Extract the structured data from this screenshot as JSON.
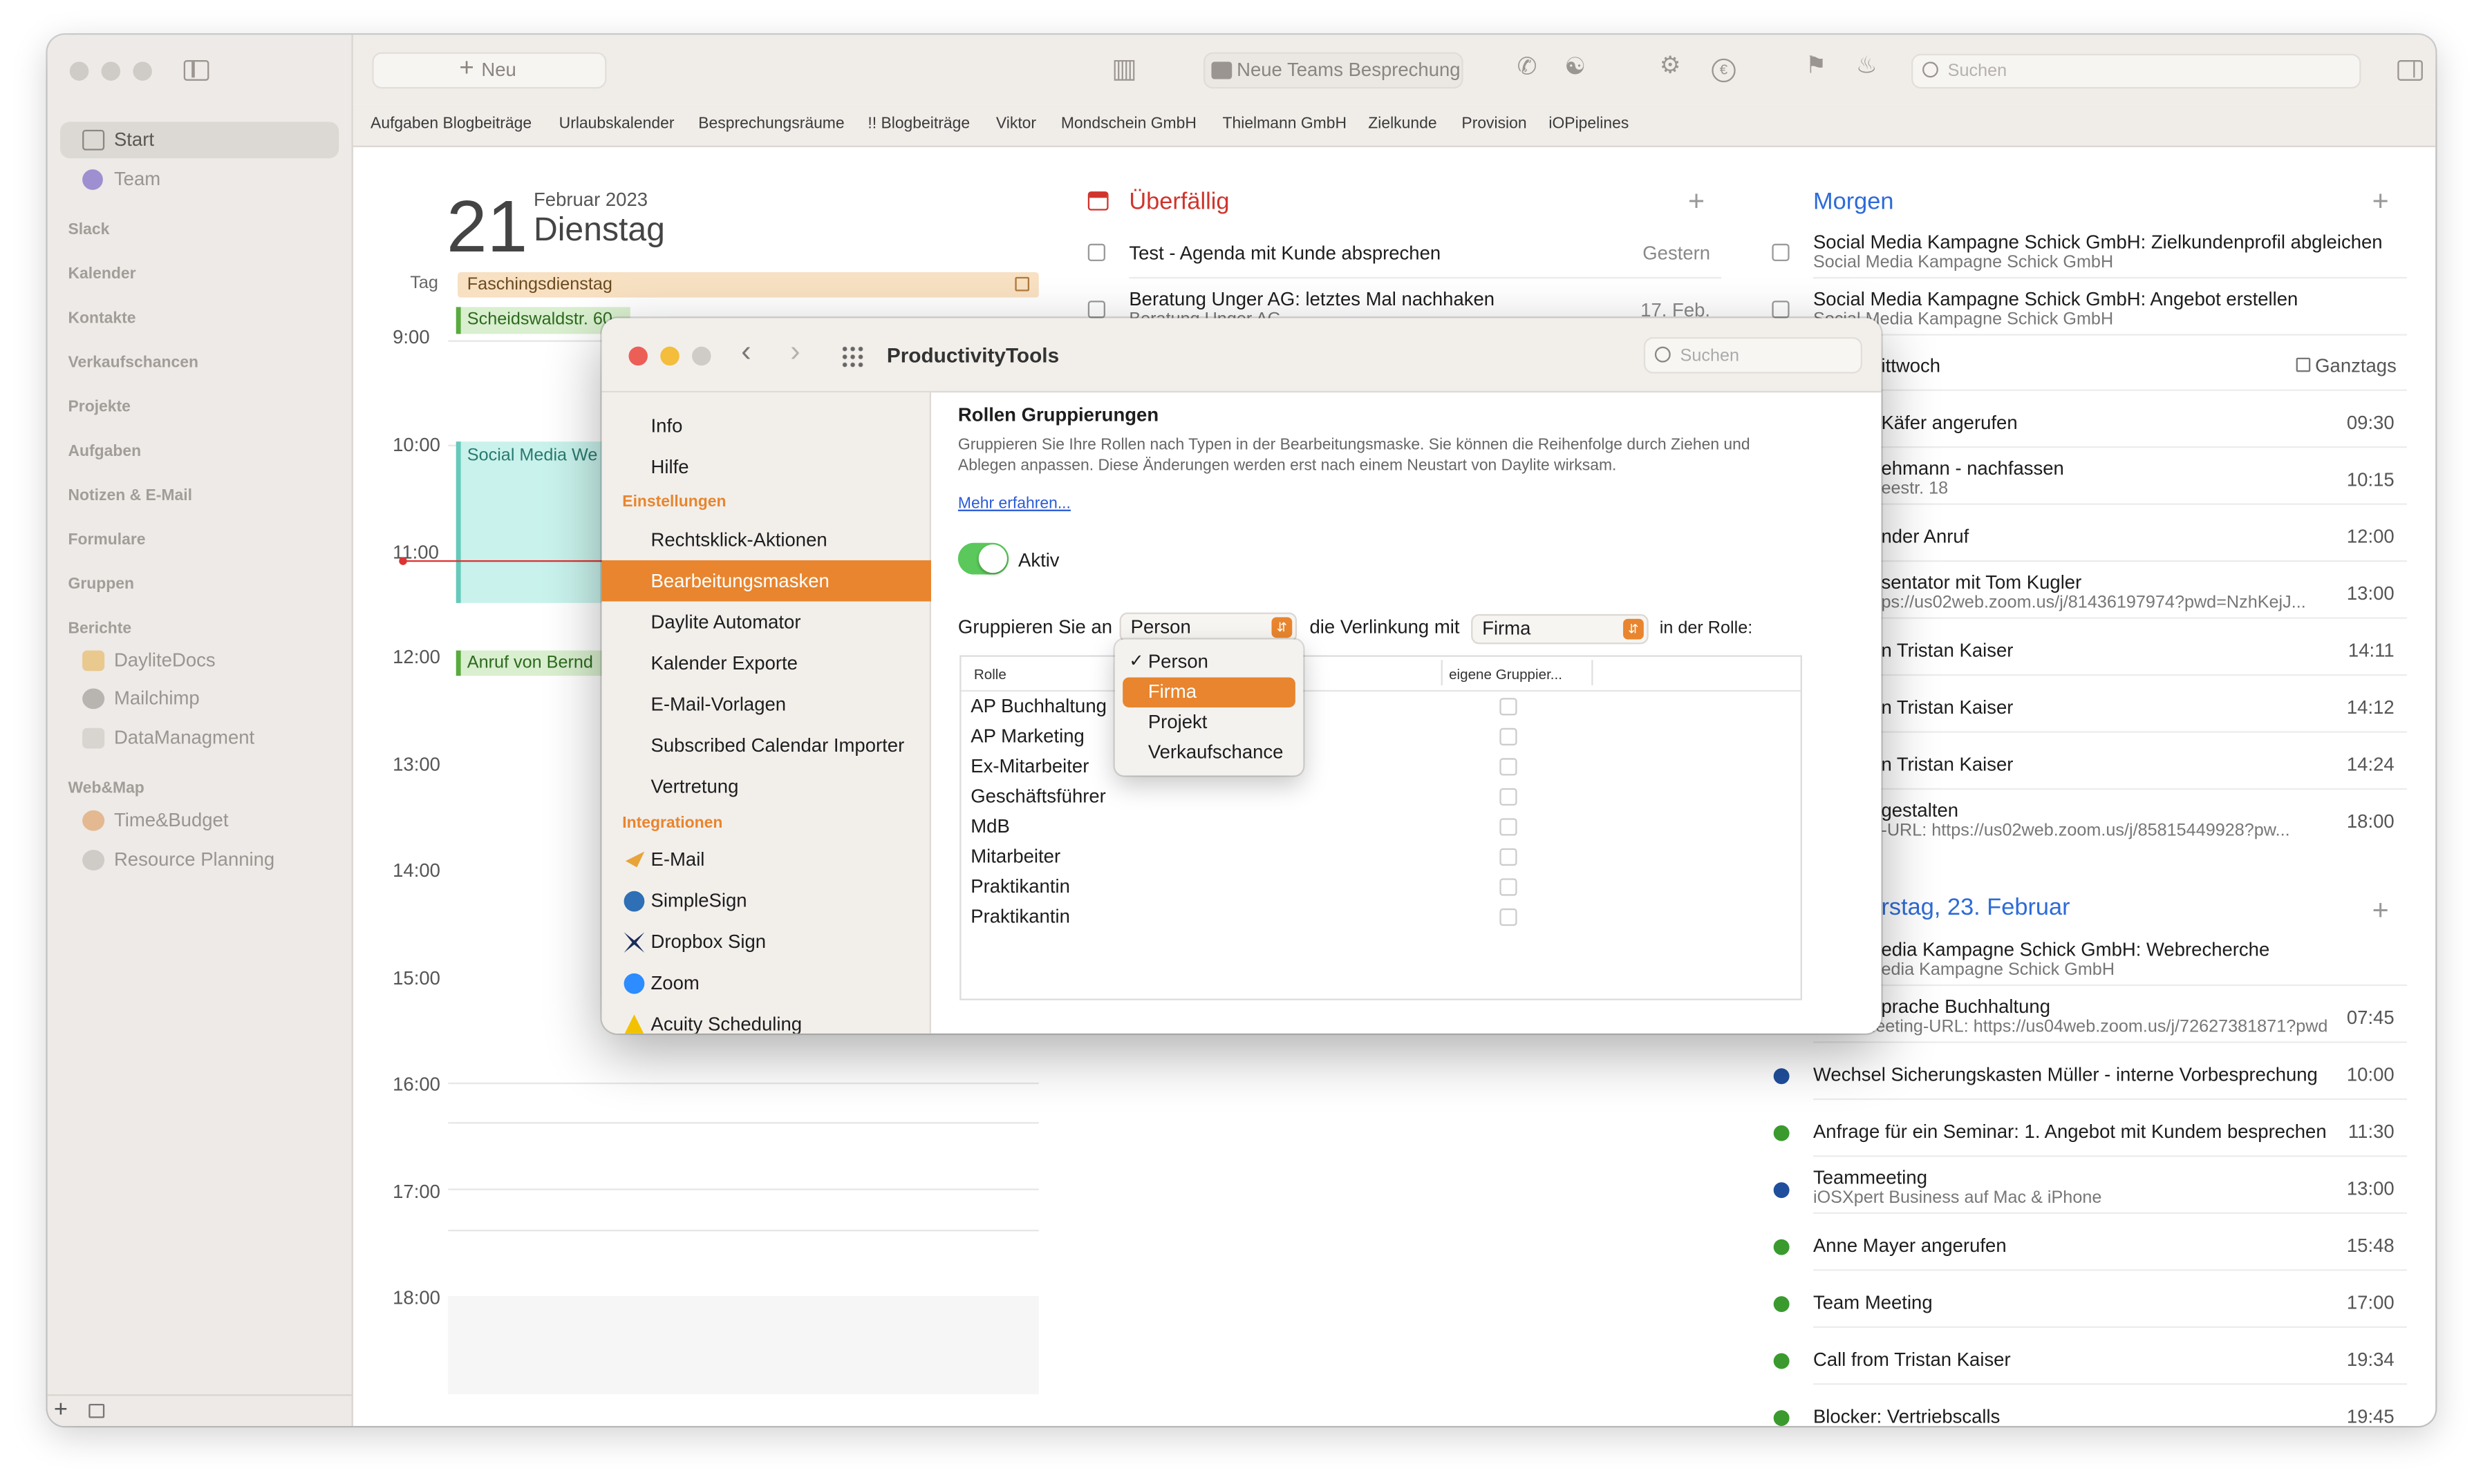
{
  "sidebar": {
    "nav": [
      {
        "label": "Start",
        "icon": "house-icon"
      },
      {
        "label": "Team",
        "icon": "team-icon"
      }
    ],
    "sections": [
      "Slack",
      "Kalender",
      "Kontakte",
      "Verkaufschancen",
      "Projekte",
      "Aufgaben",
      "Notizen & E-Mail",
      "Formulare",
      "Gruppen"
    ],
    "berichte": {
      "title": "Berichte",
      "items": [
        "DayliteDocs",
        "Mailchimp",
        "DataManagment"
      ]
    },
    "webmap": {
      "title": "Web&Map",
      "items": [
        "Time&Budget",
        "Resource Planning"
      ]
    },
    "footer": {
      "add": "+"
    }
  },
  "toolbar": {
    "new_label": "Neu",
    "teams_label": "Neue Teams Besprechung",
    "search_placeholder": "Suchen"
  },
  "favorites": [
    "Aufgaben Blogbeiträge",
    "Urlaubskalender",
    "Besprechungsräume",
    "!! Blogbeiträge",
    "Viktor",
    "Mondschein GmbH",
    "Thielmann GmbH",
    "Zielkunde",
    "Provision",
    "iOPipelines"
  ],
  "day": {
    "number": "21",
    "month_year": "Februar 2023",
    "weekday": "Dienstag",
    "tag_label": "Tag",
    "allday_event": "Faschingsdienstag",
    "hours": [
      "9:00",
      "10:00",
      "11:00",
      "12:00",
      "13:00",
      "14:00",
      "15:00",
      "16:00",
      "17:00",
      "18:00"
    ],
    "events": [
      "Scheidswaldstr. 60",
      "Social Media We",
      "Anruf von Bernd"
    ]
  },
  "overdue": {
    "title": "Überfällig",
    "add": "+",
    "items": [
      {
        "title": "Test - Agenda mit Kunde absprechen",
        "date": "Gestern"
      },
      {
        "title": "Beratung Unger AG: letztes Mal nachhaken",
        "sub": "Beratung Unger AG",
        "date": "17. Feb."
      }
    ]
  },
  "tomorrow": {
    "title": "Morgen",
    "add": "+",
    "tasks": [
      {
        "title": "Social Media Kampagne Schick GmbH: Zielkundenprofil abgleichen",
        "sub": "Social Media Kampagne Schick GmbH"
      },
      {
        "title": "Social Media Kampagne Schick GmbH: Angebot erstellen",
        "sub": "Social Media Kampagne Schick GmbH"
      }
    ],
    "subheader": "ittwoch",
    "allday_label": "Ganztags",
    "events": [
      {
        "title": "Käfer angerufen",
        "sub": "",
        "time": "09:30"
      },
      {
        "title": "ehmann - nachfassen",
        "sub": "eestr. 18",
        "time": "10:15"
      },
      {
        "title": "nder Anruf",
        "sub": "",
        "time": "12:00"
      },
      {
        "title": "sentator mit Tom Kugler",
        "sub": "ps://us02web.zoom.us/j/81436197974?pwd=NzhKejJ...",
        "time": "13:00"
      },
      {
        "title": "n Tristan Kaiser",
        "sub": "",
        "time": "14:11"
      },
      {
        "title": "n Tristan Kaiser",
        "sub": "",
        "time": "14:12"
      },
      {
        "title": "n Tristan Kaiser",
        "sub": "",
        "time": "14:24"
      },
      {
        "title": "gestalten",
        "sub": "-URL: https://us02web.zoom.us/j/85815449928?pw...",
        "time": "18:00"
      }
    ]
  },
  "thursday": {
    "title": "rstag, 23. Februar",
    "add": "+",
    "items": [
      {
        "title": "edia Kampagne Schick GmbH: Webrecherche",
        "sub": "edia Kampagne Schick GmbH",
        "time": "",
        "dot": ""
      },
      {
        "title": "prache Buchhaltung",
        "sub": "Meeting-URL: https://us04web.zoom.us/j/72627381871?pwd...",
        "time": "07:45",
        "dot": ""
      },
      {
        "title": "Wechsel Sicherungskasten Müller - interne Vorbesprechung",
        "sub": "",
        "time": "10:00",
        "dot": "#1f4f9c"
      },
      {
        "title": "Anfrage für ein Seminar: 1. Angebot mit Kundem besprechen",
        "sub": "",
        "time": "11:30",
        "dot": "#3a9a2e"
      },
      {
        "title": "Teammeeting",
        "sub": "iOSXpert Business auf Mac & iPhone",
        "time": "13:00",
        "dot": "#1f4f9c"
      },
      {
        "title": "Anne Mayer angerufen",
        "sub": "",
        "time": "15:48",
        "dot": "#3a9a2e"
      },
      {
        "title": "Team Meeting",
        "sub": "",
        "time": "17:00",
        "dot": "#3a9a2e"
      },
      {
        "title": "Call from Tristan Kaiser",
        "sub": "",
        "time": "19:34",
        "dot": "#3a9a2e"
      },
      {
        "title": "Blocker: Vertriebscalls",
        "sub": "",
        "time": "19:45",
        "dot": "#3a9a2e"
      }
    ]
  },
  "dialog": {
    "title": "ProductivityTools",
    "search_placeholder": "Suchen",
    "side_top": [
      "Info",
      "Hilfe"
    ],
    "settings_header": "Einstellungen",
    "settings": [
      "Rechtsklick-Aktionen",
      "Bearbeitungsmasken",
      "Daylite Automator",
      "Kalender Exporte",
      "E-Mail-Vorlagen",
      "Subscribed Calendar Importer",
      "Vertretung"
    ],
    "integrations_header": "Integrationen",
    "integrations": [
      {
        "label": "E-Mail",
        "icon": "paper-plane-icon",
        "color": "#e8a33a"
      },
      {
        "label": "SimpleSign",
        "icon": "simplesign-icon",
        "color": "#2e6fb6"
      },
      {
        "label": "Dropbox Sign",
        "icon": "dropbox-sign-icon",
        "color": "#1a2c5b"
      },
      {
        "label": "Zoom",
        "icon": "zoom-icon",
        "color": "#2d8cff"
      },
      {
        "label": "Acuity Scheduling",
        "icon": "acuity-icon",
        "color": "#222"
      }
    ],
    "content": {
      "heading": "Rollen Gruppierungen",
      "description": "Gruppieren Sie Ihre Rollen nach Typen in der Bearbeitungsmaske. Sie können die Reihenfolge durch Ziehen und Ablegen anpassen. Diese Änderungen werden erst nach einem Neustart von Daylite wirksam.",
      "link": "Mehr erfahren...",
      "toggle_label": "Aktiv",
      "group_label": "Gruppieren Sie an",
      "group_value": "Person",
      "link_label": "die Verlinkung mit",
      "link_value": "Firma",
      "role_label": "in der Rolle:",
      "col_role": "Rolle",
      "col_own": "eigene Gruppier...",
      "roles": [
        "AP Buchhaltung",
        "AP Marketing",
        "Ex-Mitarbeiter",
        "Geschäftsführer",
        "MdB",
        "Mitarbeiter",
        "Praktikantin",
        "Praktikantin"
      ],
      "dropdown": {
        "selected": "Person",
        "highlighted": "Firma",
        "options": [
          "Person",
          "Firma",
          "Projekt",
          "Verkaufschance"
        ]
      }
    }
  },
  "colors": {
    "accent": "#e8852e",
    "overdue": "#d0342c",
    "morgen": "#2d6bd8",
    "toggle": "#5ac85a"
  }
}
